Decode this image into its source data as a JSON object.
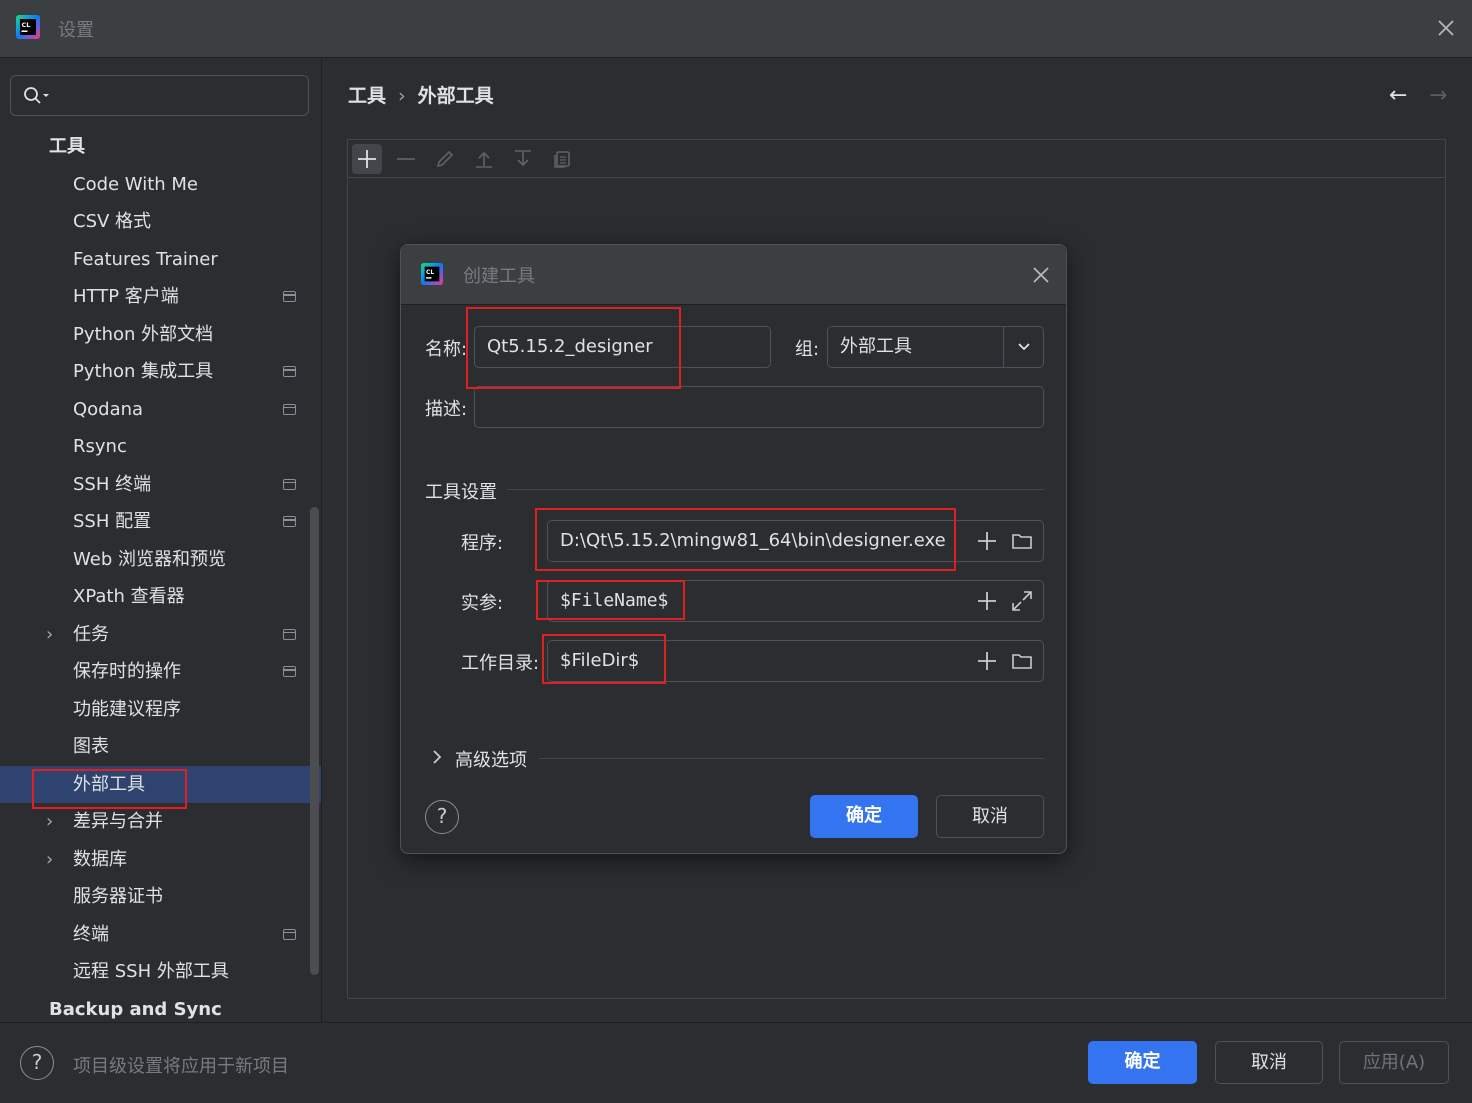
{
  "window": {
    "title": "设置"
  },
  "sidebar": {
    "items": [
      {
        "label": "工具",
        "root": true,
        "chevron": false,
        "pin": false
      },
      {
        "label": "Code With Me",
        "chevron": false,
        "pin": false
      },
      {
        "label": "CSV 格式",
        "chevron": false,
        "pin": false
      },
      {
        "label": "Features Trainer",
        "chevron": false,
        "pin": false
      },
      {
        "label": "HTTP 客户端",
        "chevron": false,
        "pin": true
      },
      {
        "label": "Python 外部文档",
        "chevron": false,
        "pin": false
      },
      {
        "label": "Python 集成工具",
        "chevron": false,
        "pin": true
      },
      {
        "label": "Qodana",
        "chevron": false,
        "pin": true
      },
      {
        "label": "Rsync",
        "chevron": false,
        "pin": false
      },
      {
        "label": "SSH 终端",
        "chevron": false,
        "pin": true
      },
      {
        "label": "SSH 配置",
        "chevron": false,
        "pin": true
      },
      {
        "label": "Web 浏览器和预览",
        "chevron": false,
        "pin": false
      },
      {
        "label": "XPath 查看器",
        "chevron": false,
        "pin": false
      },
      {
        "label": "任务",
        "chevron": true,
        "pin": true
      },
      {
        "label": "保存时的操作",
        "chevron": false,
        "pin": true
      },
      {
        "label": "功能建议程序",
        "chevron": false,
        "pin": false
      },
      {
        "label": "图表",
        "chevron": false,
        "pin": false
      },
      {
        "label": "外部工具",
        "chevron": false,
        "pin": false,
        "selected": true
      },
      {
        "label": "差异与合并",
        "chevron": true,
        "pin": false
      },
      {
        "label": "数据库",
        "chevron": true,
        "pin": false
      },
      {
        "label": "服务器证书",
        "chevron": false,
        "pin": false
      },
      {
        "label": "终端",
        "chevron": false,
        "pin": true
      },
      {
        "label": "远程 SSH 外部工具",
        "chevron": false,
        "pin": false
      },
      {
        "label": "Backup and Sync",
        "root": true,
        "chevron": false,
        "pin": false
      }
    ]
  },
  "breadcrumb": {
    "parent": "工具",
    "separator": "›",
    "current": "外部工具"
  },
  "nav": {
    "back": "←",
    "forward": "→"
  },
  "dialog": {
    "title": "创建工具",
    "name_label": "名称:",
    "name_value": "Qt5.15.2_designer",
    "group_label": "组:",
    "group_value": "外部工具",
    "desc_label": "描述:",
    "desc_value": "",
    "tool_settings_title": "工具设置",
    "program_label": "程序:",
    "program_value": "D:\\Qt\\5.15.2\\mingw81_64\\bin\\designer.exe",
    "args_label": "实参:",
    "args_value": "$FileName$",
    "workdir_label": "工作目录:",
    "workdir_value": "$FileDir$",
    "advanced_label": "高级选项",
    "ok_label": "确定",
    "cancel_label": "取消",
    "help_label": "?"
  },
  "footer": {
    "help_label": "?",
    "hint": "项目级设置将应用于新项目",
    "ok_label": "确定",
    "cancel_label": "取消",
    "apply_label": "应用(A)"
  },
  "colors": {
    "accent": "#3574f0",
    "selection": "#2e436e",
    "annotation": "#e02020"
  }
}
